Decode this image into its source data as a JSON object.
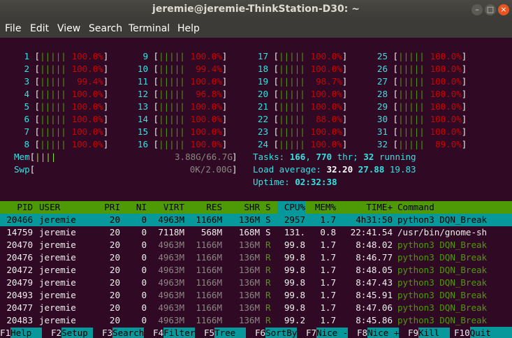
{
  "window": {
    "title": "jeremie@jeremie-ThinkStation-D30: ~",
    "minimize": "–",
    "maximize": "□",
    "close": "×"
  },
  "menu": [
    "File",
    "Edit",
    "View",
    "Search",
    "Terminal",
    "Help"
  ],
  "cpus": [
    {
      "id": "1",
      "pct": "100.0%",
      "bars": "|||||"
    },
    {
      "id": "2",
      "pct": "100.0%",
      "bars": "|||||"
    },
    {
      "id": "3",
      "pct": "99.4%",
      "bars": "|||||"
    },
    {
      "id": "4",
      "pct": "100.0%",
      "bars": "|||||"
    },
    {
      "id": "5",
      "pct": "100.0%",
      "bars": "|||||"
    },
    {
      "id": "6",
      "pct": "100.0%",
      "bars": "|||||"
    },
    {
      "id": "7",
      "pct": "100.0%",
      "bars": "|||||"
    },
    {
      "id": "8",
      "pct": "100.0%",
      "bars": "|||||"
    },
    {
      "id": "9",
      "pct": "100.0%",
      "bars": "|||||"
    },
    {
      "id": "10",
      "pct": "99.4%",
      "bars": "|||||"
    },
    {
      "id": "11",
      "pct": "100.0%",
      "bars": "|||||"
    },
    {
      "id": "12",
      "pct": "96.8%",
      "bars": "|||||"
    },
    {
      "id": "13",
      "pct": "100.0%",
      "bars": "|||||"
    },
    {
      "id": "14",
      "pct": "100.0%",
      "bars": "|||||"
    },
    {
      "id": "15",
      "pct": "100.0%",
      "bars": "|||||"
    },
    {
      "id": "16",
      "pct": "100.0%",
      "bars": "|||||"
    },
    {
      "id": "17",
      "pct": "100.0%",
      "bars": "|||||"
    },
    {
      "id": "18",
      "pct": "100.0%",
      "bars": "|||||"
    },
    {
      "id": "19",
      "pct": "98.7%",
      "bars": "|||||"
    },
    {
      "id": "20",
      "pct": "100.0%",
      "bars": "|||||"
    },
    {
      "id": "21",
      "pct": "100.0%",
      "bars": "|||||"
    },
    {
      "id": "22",
      "pct": "88.0%",
      "bars": "|||||"
    },
    {
      "id": "23",
      "pct": "100.0%",
      "bars": "|||||"
    },
    {
      "id": "24",
      "pct": "100.0%",
      "bars": "|||||"
    },
    {
      "id": "25",
      "pct": "100.0%",
      "bars": "|||||"
    },
    {
      "id": "26",
      "pct": "100.0%",
      "bars": "|||||"
    },
    {
      "id": "27",
      "pct": "100.0%",
      "bars": "|||||"
    },
    {
      "id": "28",
      "pct": "100.0%",
      "bars": "|||||"
    },
    {
      "id": "29",
      "pct": "100.0%",
      "bars": "|||||"
    },
    {
      "id": "30",
      "pct": "100.0%",
      "bars": "|||||"
    },
    {
      "id": "31",
      "pct": "100.0%",
      "bars": "|||||"
    },
    {
      "id": "32",
      "pct": "89.0%",
      "bars": "|||||"
    }
  ],
  "mem": {
    "label": "Mem",
    "bars": "||||",
    "value": "3.88G/66.7G"
  },
  "swp": {
    "label": "Swp",
    "bars": "",
    "value": "0K/2.00G"
  },
  "tasks": {
    "label": "Tasks: ",
    "count": "166",
    "sep": ", ",
    "threads": "770",
    "thr_label": " thr; ",
    "running": "32",
    "run_label": " running"
  },
  "load": {
    "label": "Load average: ",
    "l1": "32.20",
    "l5": "27.88",
    "l15": "19.83"
  },
  "uptime": {
    "label": "Uptime: ",
    "value": "02:32:38"
  },
  "columns": [
    "PID",
    "USER",
    "PRI",
    "NI",
    "VIRT",
    "RES",
    "SHR",
    "S",
    "CPU%",
    "MEM%",
    "TIME+",
    "Command"
  ],
  "processes": [
    {
      "pid": "20466",
      "user": "jeremie",
      "pri": "20",
      "ni": "0",
      "virt": "4963M",
      "res": "1166M",
      "shr": "136M",
      "s": "S",
      "cpu": "2957",
      "mem": "1.7",
      "time": "4h31:50",
      "cmd": "python3 DQN_Break"
    },
    {
      "pid": "14759",
      "user": "jeremie",
      "pri": "20",
      "ni": "0",
      "virt": "7118M",
      "res": "568M",
      "shr": "168M",
      "s": "S",
      "cpu": "131.",
      "mem": "0.8",
      "time": "22:41.54",
      "cmd": "/usr/bin/gnome-sh"
    },
    {
      "pid": "20470",
      "user": "jeremie",
      "pri": "20",
      "ni": "0",
      "virt": "4963M",
      "res": "1166M",
      "shr": "136M",
      "s": "R",
      "cpu": "99.8",
      "mem": "1.7",
      "time": "8:48.02",
      "cmd": "python3 DQN_Break"
    },
    {
      "pid": "20476",
      "user": "jeremie",
      "pri": "20",
      "ni": "0",
      "virt": "4963M",
      "res": "1166M",
      "shr": "136M",
      "s": "R",
      "cpu": "99.8",
      "mem": "1.7",
      "time": "8:46.77",
      "cmd": "python3 DQN_Break"
    },
    {
      "pid": "20472",
      "user": "jeremie",
      "pri": "20",
      "ni": "0",
      "virt": "4963M",
      "res": "1166M",
      "shr": "136M",
      "s": "R",
      "cpu": "99.8",
      "mem": "1.7",
      "time": "8:48.05",
      "cmd": "python3 DQN_Break"
    },
    {
      "pid": "20479",
      "user": "jeremie",
      "pri": "20",
      "ni": "0",
      "virt": "4963M",
      "res": "1166M",
      "shr": "136M",
      "s": "R",
      "cpu": "99.8",
      "mem": "1.7",
      "time": "8:47.43",
      "cmd": "python3 DQN_Break"
    },
    {
      "pid": "20493",
      "user": "jeremie",
      "pri": "20",
      "ni": "0",
      "virt": "4963M",
      "res": "1166M",
      "shr": "136M",
      "s": "R",
      "cpu": "99.8",
      "mem": "1.7",
      "time": "8:45.91",
      "cmd": "python3 DQN_Break"
    },
    {
      "pid": "20477",
      "user": "jeremie",
      "pri": "20",
      "ni": "0",
      "virt": "4963M",
      "res": "1166M",
      "shr": "136M",
      "s": "R",
      "cpu": "99.8",
      "mem": "1.7",
      "time": "8:47.06",
      "cmd": "python3 DQN_Break"
    },
    {
      "pid": "20483",
      "user": "jeremie",
      "pri": "20",
      "ni": "0",
      "virt": "4963M",
      "res": "1166M",
      "shr": "136M",
      "s": "R",
      "cpu": "99.2",
      "mem": "1.7",
      "time": "8:45.86",
      "cmd": "python3 DQN_Break"
    }
  ],
  "fkeys": [
    {
      "key": "F1",
      "label": "Help  "
    },
    {
      "key": "F2",
      "label": "Setup "
    },
    {
      "key": "F3",
      "label": "Search"
    },
    {
      "key": "F4",
      "label": "Filter"
    },
    {
      "key": "F5",
      "label": "Tree  "
    },
    {
      "key": "F6",
      "label": "SortBy"
    },
    {
      "key": "F7",
      "label": "Nice -"
    },
    {
      "key": "F8",
      "label": "Nice +"
    },
    {
      "key": "F9",
      "label": "Kill  "
    },
    {
      "key": "F10",
      "label": "Quit"
    }
  ],
  "colors": {
    "background": "#300a24",
    "header_bar": "#4e9a06",
    "selection": "#06989a",
    "cpu_id": "#34e2e2",
    "close_button": "#e95420"
  }
}
